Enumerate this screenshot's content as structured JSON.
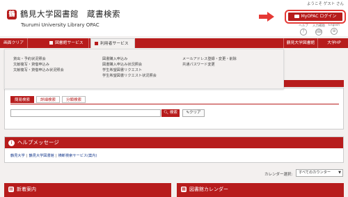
{
  "header": {
    "welcome": "ようこそ ゲスト さん",
    "logo_glyph": "鶴",
    "title_ja": "鶴見大学図書館　蔵書検索",
    "title_en": "Tsurumi University Library OPAC",
    "myopac_label": "MyOPAC ログイン",
    "icons": [
      {
        "label": "ヘルプ",
        "glyph": "?",
        "icon": "help-icon"
      },
      {
        "label": "入力補助",
        "glyph": "⌨",
        "icon": "keyboard-icon"
      },
      {
        "label": "English",
        "glyph": "⊕",
        "icon": "globe-icon"
      }
    ]
  },
  "nav": {
    "clear": "画面クリア",
    "library_services": "図書館サービス",
    "user_services": "利用者サービス",
    "library_home": "鶴見大学図書館",
    "univ_hp": "大学HP"
  },
  "dropdown": {
    "col1": [
      "貸出・予約状況照会",
      "文献複写・貸借申込み",
      "文献複写・貸借申込み状況照会"
    ],
    "col2": [
      "図書購入申込み",
      "図書購入申込み状況照会",
      "学生希望図書リクエスト",
      "学生希望図書リクエスト状況照会"
    ],
    "col3": [
      "メールアドレス登録・変更・削除",
      "共通パスワード変更"
    ]
  },
  "search": {
    "tabs": [
      "簡易検索",
      "詳細検索",
      "分類検索"
    ],
    "query": "",
    "search_button": "検索",
    "clear_button": "クリア"
  },
  "help": {
    "title": "ヘルプメッセージ",
    "links": [
      "鶴見大学",
      "鶴見大学図書館",
      "横断検索サービス(案内)"
    ]
  },
  "calendar": {
    "label": "カレンダー選択:",
    "selected": "すべてのカウンター"
  },
  "sections": {
    "news": "新着案内",
    "library_calendar": "図書館カレンダー"
  },
  "colors": {
    "accent": "#b71c1c",
    "highlight": "#e53935"
  }
}
